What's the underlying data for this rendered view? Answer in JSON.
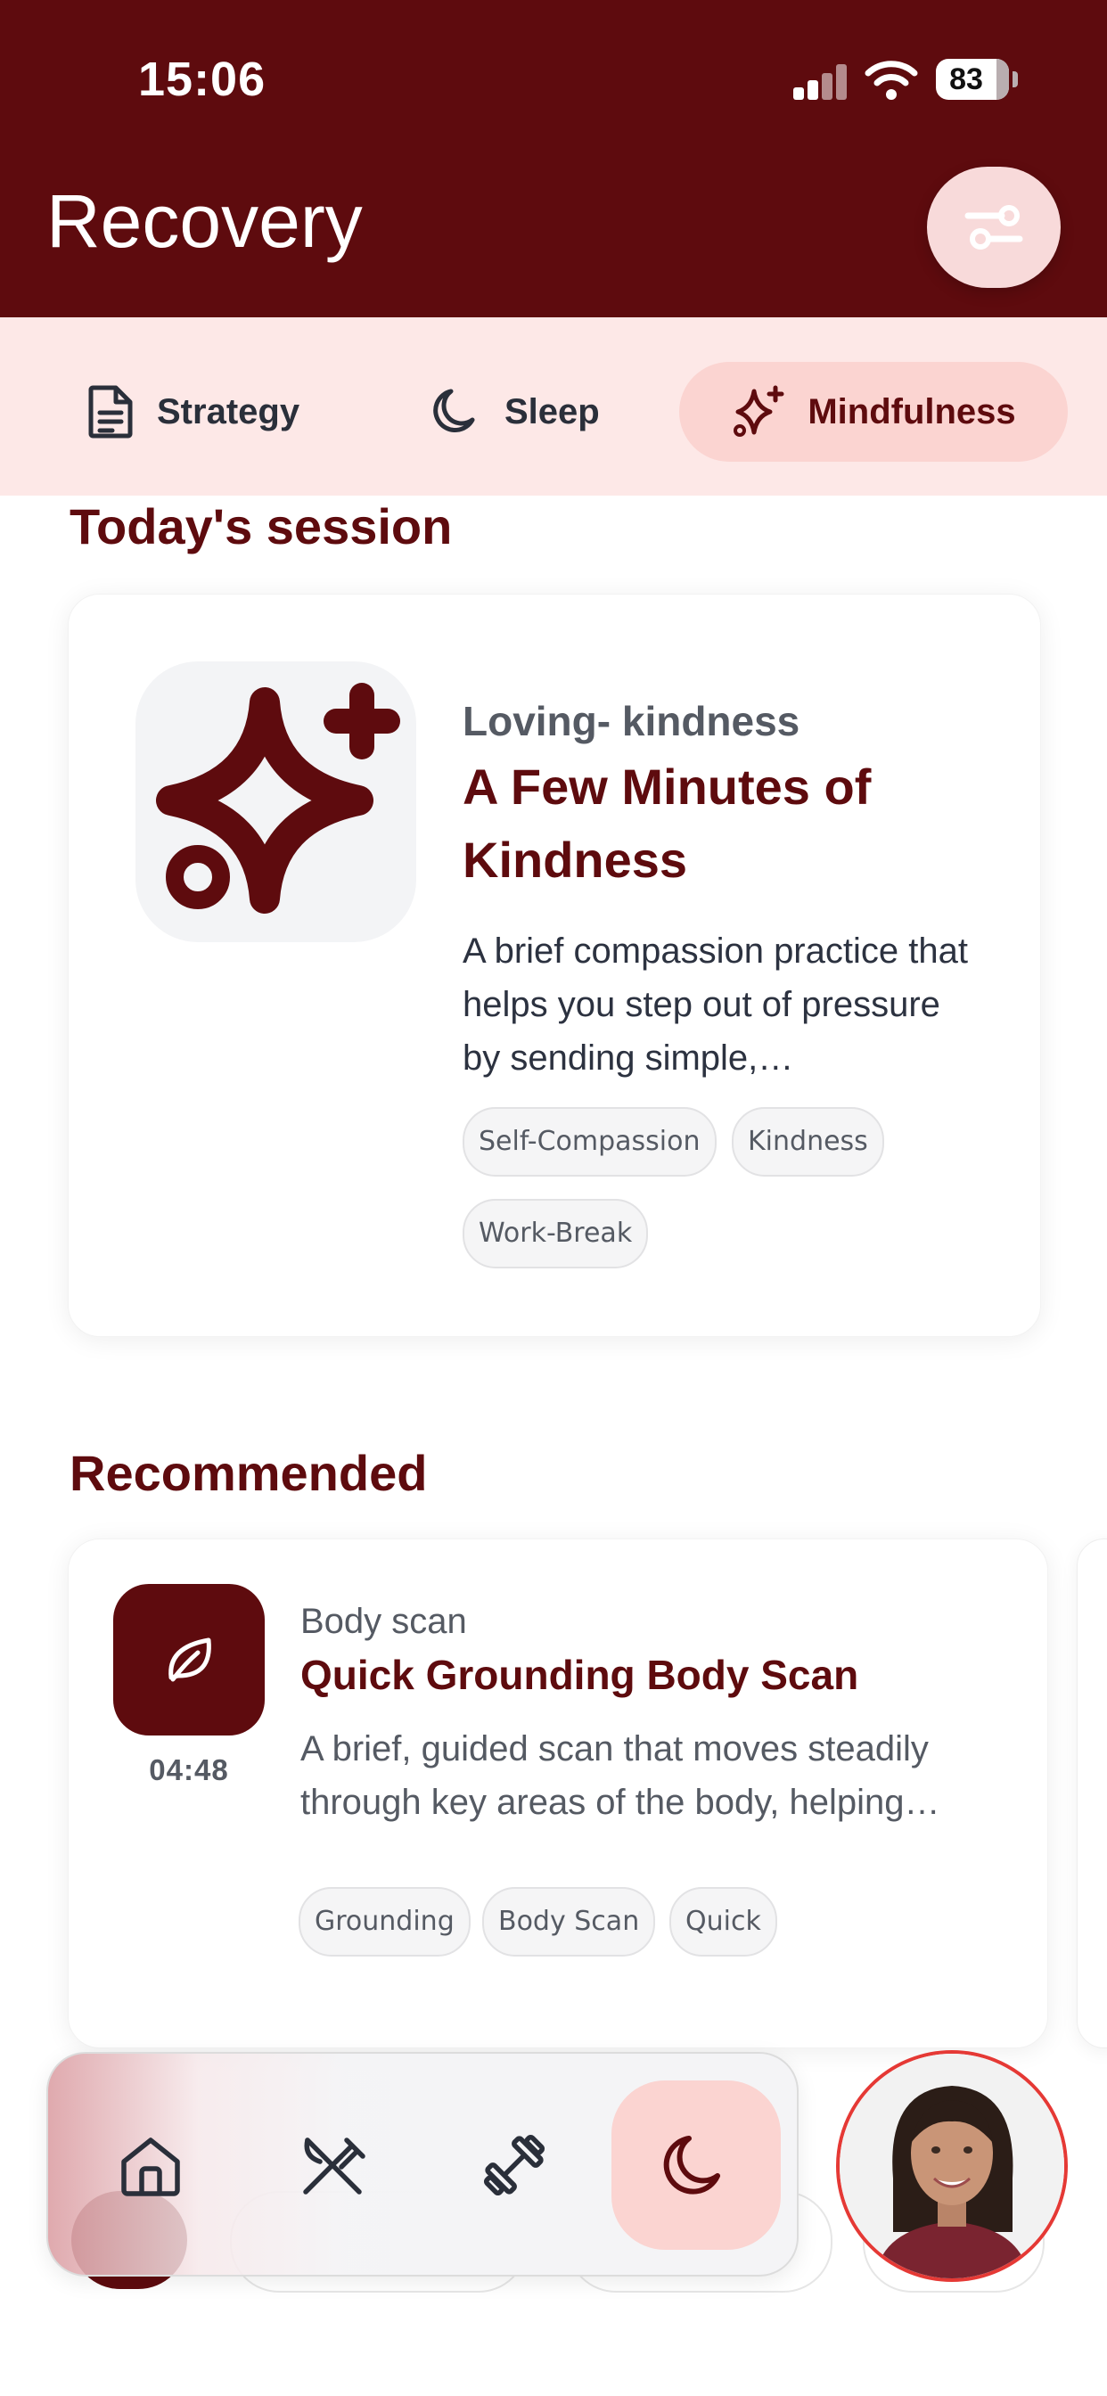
{
  "status_bar": {
    "time": "15:06",
    "battery": "83"
  },
  "header": {
    "title": "Recovery",
    "filter_icon": "sliders-icon"
  },
  "tabs": [
    {
      "label": "Strategy",
      "icon": "document-icon",
      "active": false
    },
    {
      "label": "Sleep",
      "icon": "moon-icon",
      "active": false
    },
    {
      "label": "Mindfulness",
      "icon": "sparkles-icon",
      "active": true
    }
  ],
  "today": {
    "section_title": "Today's session",
    "icon": "sparkles-icon",
    "category": "Loving- kindness",
    "title": "A Few Minutes of Kindness",
    "description": "A brief compassion practice that helps you step out of pressure by sending simple,…",
    "tags": [
      "Self-Compassion",
      "Kindness",
      "Work-Break"
    ]
  },
  "recommended": {
    "section_title": "Recommended",
    "items": [
      {
        "icon": "leaf-icon",
        "duration": "04:48",
        "category": "Body scan",
        "title": "Quick Grounding Body Scan",
        "description": "A brief, guided scan that moves steadily through key areas of the body, helping…",
        "tags": [
          "Grounding",
          "Body Scan",
          "Quick"
        ]
      }
    ]
  },
  "bottom_nav": [
    {
      "icon": "home-icon",
      "active": false
    },
    {
      "icon": "fork-knife-icon",
      "active": false
    },
    {
      "icon": "dumbbell-icon",
      "active": false
    },
    {
      "icon": "moon-icon",
      "active": true
    }
  ],
  "colors": {
    "primary": "#5e0b0e",
    "tab_bg": "#fde8e7",
    "active_pill": "#fbd4d1",
    "avatar_ring": "#e53935"
  }
}
